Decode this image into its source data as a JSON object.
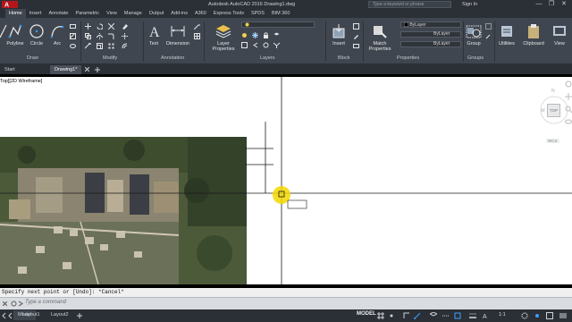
{
  "window": {
    "title": "Autodesk AutoCAD 2016    Drawing1.dwg",
    "search_placeholder": "Type a keyword or phrase",
    "sign_in": "Sign In",
    "minimize": "—",
    "restore": "❐",
    "close": "✕"
  },
  "ribbon_tabs": [
    "Home",
    "Insert",
    "Annotate",
    "Parametric",
    "View",
    "Manage",
    "Output",
    "Add-ins",
    "A360",
    "Express Tools",
    "SPDS",
    "BIM 360"
  ],
  "active_tab": "Home",
  "ribbon": {
    "draw": {
      "label": "Draw",
      "polyline": "Polyline",
      "circle": "Circle",
      "arc": "Arc"
    },
    "modify": {
      "label": "Modify"
    },
    "annotation": {
      "label": "Annotation",
      "text": "Text",
      "dimension": "Dimension"
    },
    "layers": {
      "label": "Layers",
      "layer_properties": "Layer Properties"
    },
    "block": {
      "label": "Block",
      "insert": "Insert"
    },
    "properties": {
      "label": "Properties",
      "match_properties": "Match Properties",
      "color": "ByLayer",
      "linetype": "ByLayer",
      "lineweight": "ByLayer"
    },
    "groups": {
      "label": "Groups",
      "group": "Group"
    },
    "utilities": "Utilities",
    "clipboard": "Clipboard",
    "view": "View"
  },
  "doc_tabs": [
    "Start",
    "Drawing1*"
  ],
  "viewport_label": "Top][2D Wireframe]",
  "viewcube": {
    "north": "N",
    "west": "W",
    "top": "TOP",
    "wcs": "WCS"
  },
  "command": {
    "history": "Specify next point or [Undo]: *Cancel*",
    "placeholder": "Type a command"
  },
  "status": {
    "layouts": [
      "Model",
      "Layout1",
      "Layout2"
    ],
    "model": "MODEL",
    "scale": "1:1"
  },
  "colors": {
    "ribbon": "#40464f",
    "titlebar": "#2b2f36",
    "canvas": "#ffffff",
    "cursor_highlight": "#f5d800"
  }
}
